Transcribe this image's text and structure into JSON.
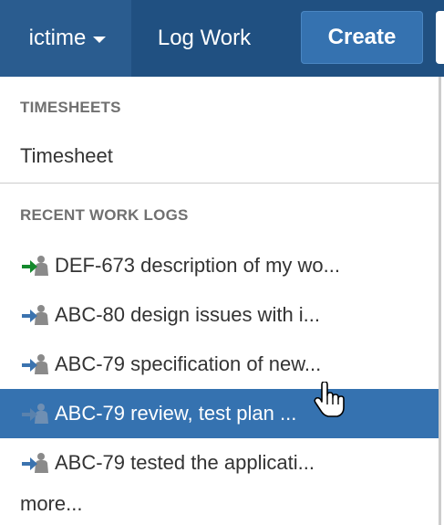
{
  "topbar": {
    "ictime_label": "ictime",
    "logwork_label": "Log Work",
    "create_label": "Create"
  },
  "menu": {
    "timesheets_heading": "TIMESHEETS",
    "timesheet_label": "Timesheet",
    "recent_heading": "RECENT WORK LOGS",
    "logs": [
      {
        "label": "DEF-673 description of my wo...",
        "icon": "user-arrow-green-icon"
      },
      {
        "label": "ABC-80 design issues with i...",
        "icon": "user-arrow-blue-icon"
      },
      {
        "label": "ABC-79 specification of new...",
        "icon": "user-arrow-blue-icon"
      },
      {
        "label": "ABC-79 review, test plan ...",
        "icon": "user-arrow-blue-icon",
        "selected": true
      },
      {
        "label": "ABC-79 tested the applicati...",
        "icon": "user-arrow-blue-icon"
      }
    ],
    "more_label": "more..."
  },
  "colors": {
    "topbar": "#205081",
    "active_nav": "#2a5c8f",
    "create_button": "#3572b0",
    "selected_row": "#3572b0",
    "arrow_green": "#14892c",
    "arrow_blue": "#3b73af"
  }
}
